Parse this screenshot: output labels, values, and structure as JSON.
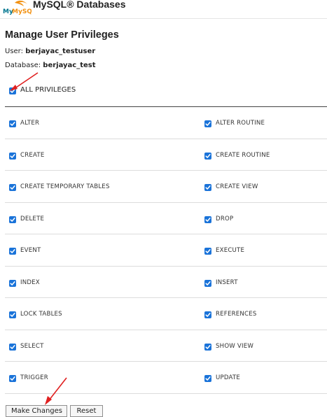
{
  "header": {
    "logo_text": "MySQL",
    "title": "MySQL® Databases"
  },
  "page_title": "Manage User Privileges",
  "user": {
    "label": "User:",
    "value": "berjayac_testuser"
  },
  "database": {
    "label": "Database:",
    "value": "berjayac_test"
  },
  "all_privileges": {
    "label": "ALL PRIVILEGES",
    "checked": true
  },
  "privileges": [
    {
      "left": "ALTER",
      "right": "ALTER ROUTINE"
    },
    {
      "left": "CREATE",
      "right": "CREATE ROUTINE"
    },
    {
      "left": "CREATE TEMPORARY TABLES",
      "right": "CREATE VIEW"
    },
    {
      "left": "DELETE",
      "right": "DROP"
    },
    {
      "left": "EVENT",
      "right": "EXECUTE"
    },
    {
      "left": "INDEX",
      "right": "INSERT"
    },
    {
      "left": "LOCK TABLES",
      "right": "REFERENCES"
    },
    {
      "left": "SELECT",
      "right": "SHOW VIEW"
    },
    {
      "left": "TRIGGER",
      "right": "UPDATE"
    }
  ],
  "buttons": {
    "make_changes": "Make Changes",
    "reset": "Reset"
  },
  "colors": {
    "checkbox": "#1a73d9",
    "annotation_arrow": "#e02020"
  }
}
